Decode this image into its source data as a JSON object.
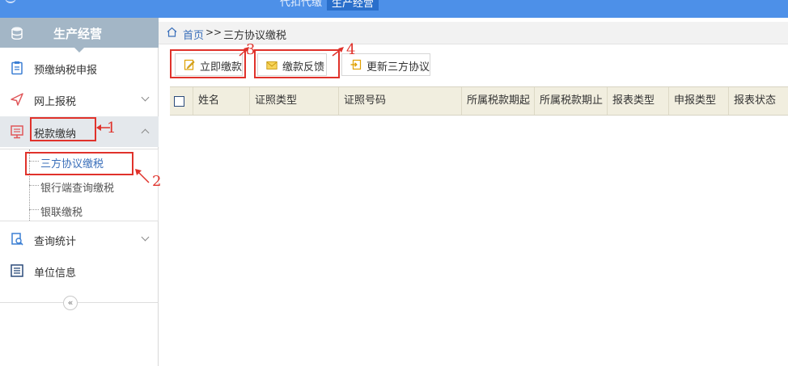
{
  "topbar": {
    "nav": [
      {
        "label": "代扣代缴",
        "active": false
      },
      {
        "label": "生产经营",
        "active": true
      }
    ]
  },
  "sidebar": {
    "title": "生产经营",
    "items": [
      {
        "label": "预缴纳税申报",
        "icon": "clipboard-icon"
      },
      {
        "label": "网上报税",
        "icon": "send-icon",
        "expandable": true
      },
      {
        "label": "税款缴纳",
        "icon": "monitor-icon",
        "expandable": true,
        "expanded": true
      },
      {
        "label": "查询统计",
        "icon": "search-doc-icon",
        "expandable": true
      },
      {
        "label": "单位信息",
        "icon": "list-icon"
      }
    ],
    "submenu": [
      {
        "label": "三方协议缴税",
        "active": true
      },
      {
        "label": "银行端查询缴税"
      },
      {
        "label": "银联缴税"
      }
    ],
    "collapse_symbol": "«"
  },
  "breadcrumb": {
    "home": "首页",
    "separator": ">>",
    "current": "三方协议缴税"
  },
  "toolbar": {
    "pay_now": "立即缴款",
    "pay_feedback": "缴款反馈",
    "update_agreement": "更新三方协议"
  },
  "table": {
    "columns": [
      "姓名",
      "证照类型",
      "证照号码",
      "所属税款期起",
      "所属税款期止",
      "报表类型",
      "申报类型",
      "报表状态"
    ]
  },
  "annotations": [
    "1",
    "2",
    "3",
    "4"
  ],
  "colors": {
    "topbar": "#4d90e8",
    "sidebar_header": "#a3b6c6",
    "annotation": "#e0322b",
    "table_header": "#f1eedf",
    "link": "#3a6fba"
  }
}
